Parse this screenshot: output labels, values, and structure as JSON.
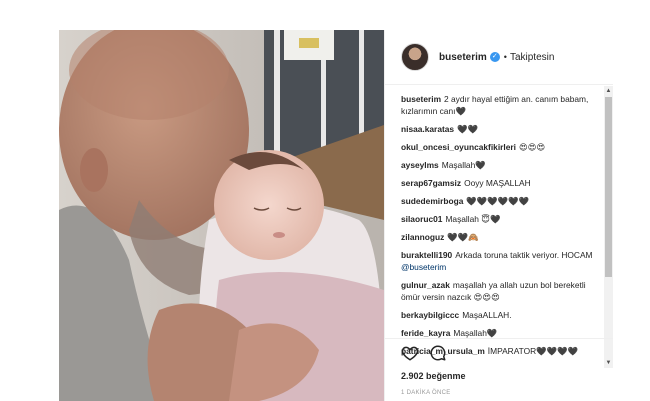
{
  "post": {
    "username": "buseterim",
    "follow_status": "Takiptesin",
    "likes_text": "2.902 beğenme",
    "time_text": "1 DAKİKA ÖNCE"
  },
  "comments": [
    {
      "user": "buseterim",
      "text": "2 aydır hayal ettiğim an. canım babam, kızlarımın canı🖤"
    },
    {
      "user": "nisaa.karatas",
      "text": "🖤🖤"
    },
    {
      "user": "okul_oncesi_oyuncakfikirleri",
      "text": "😍😍😍"
    },
    {
      "user": "ayseylms",
      "text": "Maşallah🖤"
    },
    {
      "user": "serap67gamsiz",
      "text": "Ooyy MAŞALLAH"
    },
    {
      "user": "sudedemirboga",
      "text": "🖤🖤🖤🖤🖤🖤"
    },
    {
      "user": "silaoruc01",
      "text": "Maşallah 😇🖤"
    },
    {
      "user": "zilannoguz",
      "text": "🖤🖤🙈"
    },
    {
      "user": "buraktelli190",
      "text": "Arkada toruna taktik veriyor. HOCAM",
      "mention": "@buseterim"
    },
    {
      "user": "gulnur_azak",
      "text": "maşallah ya allah uzun bol bereketli ömür versin nazcık 😍😍😍"
    },
    {
      "user": "berkaybilgiccc",
      "text": "MaşaALLAH."
    },
    {
      "user": "feride_kayra",
      "text": "Maşallah🖤"
    },
    {
      "user": "patricia_m_ursula_m",
      "text": "İMPARATOR🖤🖤🖤🖤"
    }
  ],
  "colors": {
    "mention": "#003569",
    "verified": "#3897f0",
    "border": "#efefef"
  },
  "icons": {
    "like": "heart-icon",
    "comment": "comment-bubble-icon",
    "verified": "verified-badge-icon"
  }
}
